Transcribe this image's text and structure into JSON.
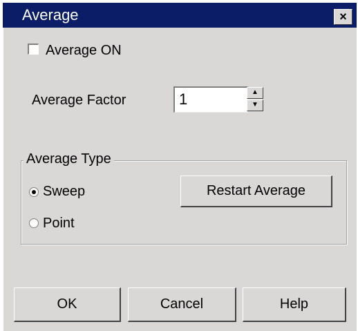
{
  "window": {
    "title": "Average",
    "close_glyph": "×"
  },
  "average_on": {
    "label": "Average ON",
    "checked": false
  },
  "average_factor": {
    "label": "Average Factor",
    "value": "1",
    "up_glyph": "▲",
    "down_glyph": "▼"
  },
  "average_type": {
    "legend": "Average Type",
    "options": [
      {
        "label": "Sweep",
        "selected": true
      },
      {
        "label": "Point",
        "selected": false
      }
    ],
    "restart_label": "Restart Average"
  },
  "buttons": {
    "ok": "OK",
    "cancel": "Cancel",
    "help": "Help"
  },
  "colors": {
    "titlebar": "#0a1d66",
    "dialog_face": "#d9d8d6"
  }
}
